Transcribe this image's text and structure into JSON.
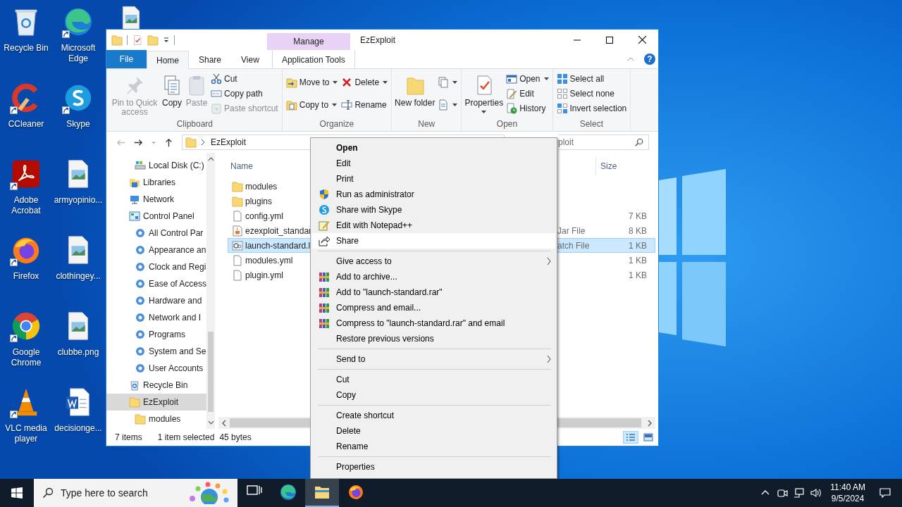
{
  "desktop": {
    "icons": [
      {
        "label": "Recycle Bin",
        "kind": "recycle",
        "shortcut": false
      },
      {
        "label": "Microsoft Edge",
        "kind": "edge",
        "shortcut": true
      },
      {
        "label": "CCleaner",
        "kind": "ccleaner",
        "shortcut": true
      },
      {
        "label": "Skype",
        "kind": "skype",
        "shortcut": true
      },
      {
        "label": "Adobe Acrobat",
        "kind": "acrobat",
        "shortcut": true
      },
      {
        "label": "armyopinio...",
        "kind": "image",
        "shortcut": false
      },
      {
        "label": "Firefox",
        "kind": "firefox",
        "shortcut": true
      },
      {
        "label": "clothingey...",
        "kind": "image",
        "shortcut": false
      },
      {
        "label": "Google Chrome",
        "kind": "chrome",
        "shortcut": true
      },
      {
        "label": "clubbe.png",
        "kind": "image",
        "shortcut": false
      },
      {
        "label": "VLC media player",
        "kind": "vlc",
        "shortcut": true
      },
      {
        "label": "decisionge...",
        "kind": "word",
        "shortcut": false
      }
    ]
  },
  "window": {
    "tab_group": "Manage",
    "title": "EzExploit",
    "help": "?"
  },
  "tabs": [
    {
      "label": "File",
      "kind": "file",
      "selected": false
    },
    {
      "label": "Home",
      "kind": "normal",
      "selected": true
    },
    {
      "label": "Share",
      "kind": "normal",
      "selected": false
    },
    {
      "label": "View",
      "kind": "normal",
      "selected": false
    },
    {
      "label": "Application Tools",
      "kind": "contextual",
      "selected": false
    }
  ],
  "ribbon": {
    "groups": [
      {
        "label": "Clipboard",
        "columns": [
          {
            "kind": "large",
            "buttons": [
              {
                "label": "Pin to Quick access",
                "disabled": true,
                "dropdown": false
              }
            ]
          },
          {
            "kind": "large",
            "buttons": [
              {
                "label": "Copy",
                "disabled": false,
                "dropdown": false
              }
            ]
          },
          {
            "kind": "large",
            "buttons": [
              {
                "label": "Paste",
                "disabled": true,
                "dropdown": false
              }
            ]
          },
          {
            "kind": "small",
            "buttons": [
              {
                "label": "Cut",
                "disabled": false,
                "dropdown": false
              },
              {
                "label": "Copy path",
                "disabled": false,
                "dropdown": false
              },
              {
                "label": "Paste shortcut",
                "disabled": true,
                "dropdown": false
              }
            ]
          }
        ]
      },
      {
        "label": "Organize",
        "columns": [
          {
            "kind": "small",
            "buttons": [
              {
                "label": "Move to",
                "disabled": false,
                "dropdown": true
              },
              {
                "label": "Copy to",
                "disabled": false,
                "dropdown": true
              }
            ]
          },
          {
            "kind": "small",
            "buttons": [
              {
                "label": "Delete",
                "disabled": false,
                "dropdown": true
              },
              {
                "label": "Rename",
                "disabled": false,
                "dropdown": false
              }
            ]
          }
        ]
      },
      {
        "label": "New",
        "columns": [
          {
            "kind": "large",
            "buttons": [
              {
                "label": "New folder",
                "disabled": false,
                "dropdown": false
              }
            ]
          },
          {
            "kind": "small",
            "buttons": [
              {
                "disabled": false,
                "dropdown": true
              },
              {
                "disabled": false,
                "dropdown": true
              }
            ]
          }
        ]
      },
      {
        "label": "Open",
        "columns": [
          {
            "kind": "large",
            "buttons": [
              {
                "label": "Properties",
                "disabled": false,
                "dropdown": true
              }
            ]
          },
          {
            "kind": "small",
            "buttons": [
              {
                "label": "Open",
                "disabled": false,
                "dropdown": true
              },
              {
                "label": "Edit",
                "disabled": false,
                "dropdown": false
              },
              {
                "label": "History",
                "disabled": false,
                "dropdown": false
              }
            ]
          }
        ]
      },
      {
        "label": "Select",
        "columns": [
          {
            "kind": "small",
            "buttons": [
              {
                "label": "Select all",
                "disabled": false,
                "dropdown": false
              },
              {
                "label": "Select none",
                "disabled": false,
                "dropdown": false
              },
              {
                "label": "Invert selection",
                "disabled": false,
                "dropdown": false
              }
            ]
          }
        ]
      }
    ]
  },
  "address": {
    "buttons": [
      {
        "kind": "back",
        "disabled": true
      },
      {
        "kind": "forward",
        "disabled": false
      },
      {
        "kind": "recent",
        "disabled": false
      },
      {
        "kind": "up",
        "disabled": false
      }
    ],
    "path": [
      "EzExploit"
    ]
  },
  "search": {
    "placeholder": "ploit"
  },
  "navigation": {
    "items": [
      {
        "label": "Local Disk (C:)",
        "kind": "drive",
        "selected": false
      },
      {
        "label": "Libraries",
        "kind": "libraries",
        "selected": false
      },
      {
        "label": "Network",
        "kind": "network",
        "selected": false
      },
      {
        "label": "Control Panel",
        "kind": "control",
        "selected": false,
        "children": [
          {
            "label": "All Control Par",
            "kind": "setting",
            "selected": false
          },
          {
            "label": "Appearance an",
            "kind": "setting",
            "selected": false
          },
          {
            "label": "Clock and Regi",
            "kind": "setting",
            "selected": false
          },
          {
            "label": "Ease of Access",
            "kind": "setting",
            "selected": false
          },
          {
            "label": "Hardware and",
            "kind": "setting",
            "selected": false
          },
          {
            "label": "Network and I",
            "kind": "setting",
            "selected": false
          },
          {
            "label": "Programs",
            "kind": "setting",
            "selected": false
          },
          {
            "label": "System and Se",
            "kind": "setting",
            "selected": false
          },
          {
            "label": "User Accounts",
            "kind": "setting",
            "selected": false
          }
        ]
      },
      {
        "label": "Recycle Bin",
        "kind": "recycle",
        "selected": false
      },
      {
        "label": "EzExploit",
        "kind": "folder",
        "selected": true,
        "children": [
          {
            "label": "modules",
            "kind": "folder",
            "selected": false
          }
        ]
      }
    ]
  },
  "files": {
    "columns": [
      {
        "label": "Name"
      },
      {
        "label": "Size"
      }
    ],
    "rows": [
      {
        "name": "modules",
        "kind": "folder",
        "selected": false
      },
      {
        "name": "plugins",
        "kind": "folder",
        "selected": false
      },
      {
        "name": "config.yml",
        "kind": "file",
        "size": "7 KB",
        "selected": false
      },
      {
        "name": "ezexploit_standar",
        "kind": "jar",
        "type": "Jar File",
        "size": "8 KB",
        "selected": false
      },
      {
        "name": "launch-standard.l",
        "kind": "batch",
        "type": "atch File",
        "size": "1 KB",
        "selected": true
      },
      {
        "name": "modules.yml",
        "kind": "file",
        "size": "1 KB",
        "selected": false
      },
      {
        "name": "plugin.yml",
        "kind": "file",
        "size": "1 KB",
        "selected": false
      }
    ]
  },
  "status_bar": {
    "count": "7 items",
    "selection": "1 item selected",
    "size": "45 bytes",
    "views": [
      {
        "kind": "details",
        "selected": true
      },
      {
        "kind": "tiles",
        "selected": false
      }
    ]
  },
  "context_menu": {
    "items": [
      {
        "kind": "plain",
        "label": "Open",
        "default": true,
        "selected": false
      },
      {
        "kind": "plain",
        "label": "Edit",
        "default": false,
        "selected": false
      },
      {
        "kind": "plain",
        "label": "Print",
        "default": false,
        "selected": false
      },
      {
        "kind": "shield",
        "label": "Run as administrator",
        "default": false,
        "selected": false
      },
      {
        "kind": "skype",
        "label": "Share with Skype",
        "default": false,
        "selected": false
      },
      {
        "kind": "notepad",
        "label": "Edit with Notepad++",
        "default": false,
        "selected": false
      },
      {
        "kind": "share",
        "label": "Share",
        "default": false,
        "selected": true
      },
      {
        "kind": "separator"
      },
      {
        "kind": "submenu",
        "label": "Give access to",
        "default": false,
        "selected": false
      },
      {
        "kind": "archive",
        "label": "Add to archive...",
        "default": false,
        "selected": false
      },
      {
        "kind": "archive",
        "label": "Add to \"launch-standard.rar\"",
        "default": false,
        "selected": false
      },
      {
        "kind": "archive",
        "label": "Compress and email...",
        "default": false,
        "selected": false
      },
      {
        "kind": "archive",
        "label": "Compress to \"launch-standard.rar\" and email",
        "default": false,
        "selected": false
      },
      {
        "kind": "plain",
        "label": "Restore previous versions",
        "default": false,
        "selected": false
      },
      {
        "kind": "separator"
      },
      {
        "kind": "submenu",
        "label": "Send to",
        "default": false,
        "selected": false
      },
      {
        "kind": "separator"
      },
      {
        "kind": "plain",
        "label": "Cut",
        "default": false,
        "selected": false
      },
      {
        "kind": "plain",
        "label": "Copy",
        "default": false,
        "selected": false
      },
      {
        "kind": "separator"
      },
      {
        "kind": "plain",
        "label": "Create shortcut",
        "default": false,
        "selected": false
      },
      {
        "kind": "plain",
        "label": "Delete",
        "default": false,
        "selected": false
      },
      {
        "kind": "plain",
        "label": "Rename",
        "default": false,
        "selected": false
      },
      {
        "kind": "separator"
      },
      {
        "kind": "plain",
        "label": "Properties",
        "default": false,
        "selected": false
      }
    ]
  },
  "taskbar": {
    "search_placeholder": "Type here to search",
    "apps": [
      {
        "kind": "taskview",
        "active": false
      },
      {
        "kind": "edge",
        "active": false
      },
      {
        "kind": "explorer",
        "active": true
      },
      {
        "kind": "firefox",
        "active": false
      }
    ],
    "time": "11:40 AM",
    "date": "9/5/2024"
  }
}
